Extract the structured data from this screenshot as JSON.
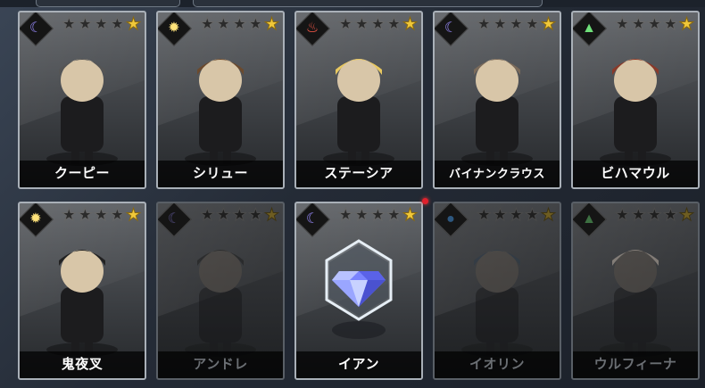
{
  "colors": {
    "moon": "#9a8cff",
    "sun": "#ffe37a",
    "fire": "#ff5a4a",
    "water": "#4aa8ff",
    "wind": "#6fe07a",
    "star_gold": "#f0c83a",
    "notification": "#e0202c"
  },
  "cards": [
    {
      "name": "クーピー",
      "element": "moon-icon",
      "glyph": "☾",
      "stars_dark": 4,
      "stars_gold": 1,
      "owned": true
    },
    {
      "name": "シリュー",
      "element": "sun-icon",
      "glyph": "✹",
      "stars_dark": 4,
      "stars_gold": 1,
      "owned": true
    },
    {
      "name": "ステーシア",
      "element": "fire-icon",
      "glyph": "♨",
      "stars_dark": 4,
      "stars_gold": 1,
      "owned": true
    },
    {
      "name": "バイナンクラウス",
      "element": "moon-icon",
      "glyph": "☾",
      "stars_dark": 4,
      "stars_gold": 1,
      "owned": true
    },
    {
      "name": "ビハマウル",
      "element": "wind-icon",
      "glyph": "▲",
      "stars_dark": 4,
      "stars_gold": 1,
      "owned": true
    },
    {
      "name": "鬼夜叉",
      "element": "sun-icon",
      "glyph": "✹",
      "stars_dark": 4,
      "stars_gold": 1,
      "owned": true
    },
    {
      "name": "アンドレ",
      "element": "moon-icon",
      "glyph": "☾",
      "stars_dark": 4,
      "stars_gold": 1,
      "owned": false
    },
    {
      "name": "イアン",
      "element": "moon-icon",
      "glyph": "☾",
      "stars_dark": 4,
      "stars_gold": 1,
      "owned": true,
      "diamond": true,
      "notify": true
    },
    {
      "name": "イオリン",
      "element": "water-icon",
      "glyph": "●",
      "stars_dark": 4,
      "stars_gold": 1,
      "owned": false
    },
    {
      "name": "ウルフィーナ",
      "element": "wind-icon",
      "glyph": "▲",
      "stars_dark": 4,
      "stars_gold": 1,
      "owned": false
    }
  ]
}
